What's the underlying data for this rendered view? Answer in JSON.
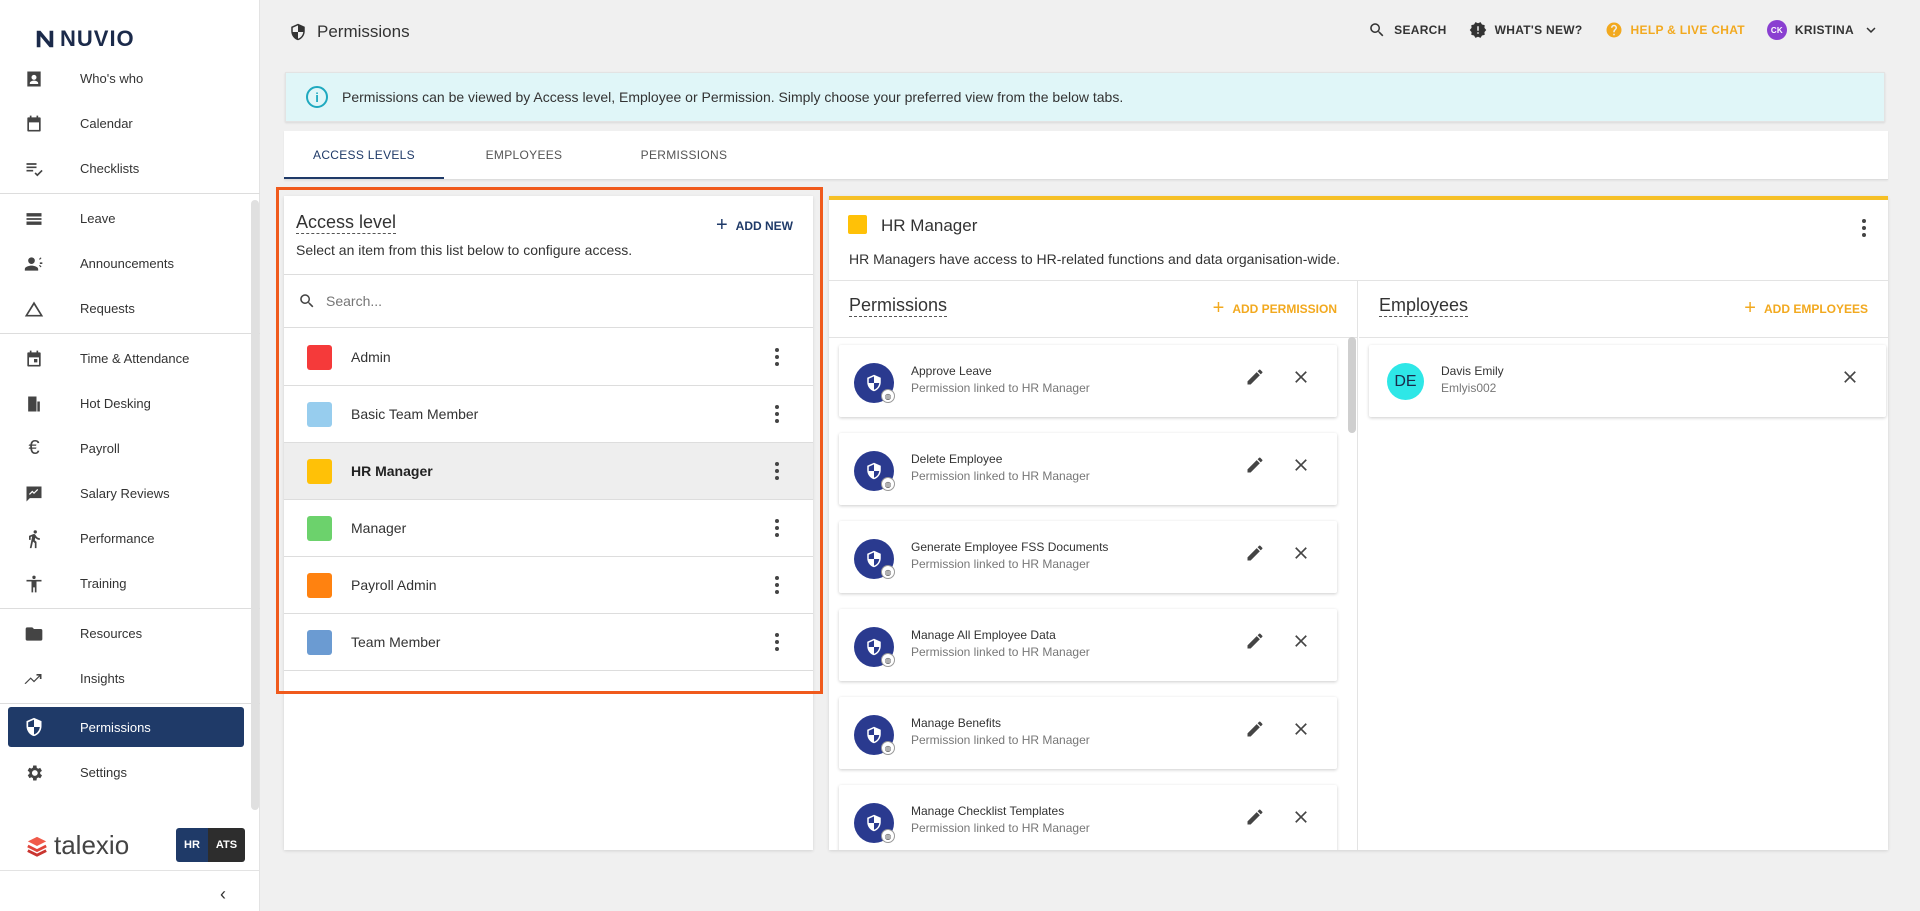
{
  "brand": {
    "logo_text": "NUVIO",
    "footer_brand": "talexio",
    "switch": [
      "HR",
      "ATS"
    ]
  },
  "sidebar": {
    "items": [
      {
        "label": "Who's who",
        "icon": "badge-icon"
      },
      {
        "label": "Calendar",
        "icon": "calendar-icon"
      },
      {
        "label": "Checklists",
        "icon": "checklist-icon"
      },
      {
        "label": "Leave",
        "icon": "leave-icon"
      },
      {
        "label": "Announcements",
        "icon": "megaphone-icon"
      },
      {
        "label": "Requests",
        "icon": "triangle-icon"
      },
      {
        "label": "Time & Attendance",
        "icon": "clock-calendar-icon"
      },
      {
        "label": "Hot Desking",
        "icon": "desk-icon"
      },
      {
        "label": "Payroll",
        "icon": "euro-icon"
      },
      {
        "label": "Salary Reviews",
        "icon": "review-icon"
      },
      {
        "label": "Performance",
        "icon": "runner-icon"
      },
      {
        "label": "Training",
        "icon": "training-icon"
      },
      {
        "label": "Resources",
        "icon": "folder-icon"
      },
      {
        "label": "Insights",
        "icon": "insights-icon"
      },
      {
        "label": "Permissions",
        "icon": "shield-icon"
      },
      {
        "label": "Settings",
        "icon": "gear-icon"
      }
    ]
  },
  "header": {
    "title": "Permissions",
    "search": "SEARCH",
    "whats_new": "WHAT'S NEW?",
    "help": "HELP & LIVE CHAT",
    "user_initials": "CK",
    "user_name": "KRISTINA"
  },
  "banner": {
    "text": "Permissions can be viewed by Access level, Employee or Permission. Simply choose your preferred view from the below tabs."
  },
  "tabs": [
    "ACCESS LEVELS",
    "EMPLOYEES",
    "PERMISSIONS"
  ],
  "access_level": {
    "title": "Access level",
    "add_new": "ADD NEW",
    "subtitle": "Select an item from this list below to configure access.",
    "search_placeholder": "Search...",
    "items": [
      {
        "label": "Admin",
        "color": "#f53a3a"
      },
      {
        "label": "Basic Team Member",
        "color": "#97cdee"
      },
      {
        "label": "HR Manager",
        "color": "#ffc107"
      },
      {
        "label": "Manager",
        "color": "#6cd26c"
      },
      {
        "label": "Payroll Admin",
        "color": "#ff8210"
      },
      {
        "label": "Team Member",
        "color": "#6b9bd2"
      }
    ]
  },
  "detail": {
    "title": "HR Manager",
    "color": "#ffc107",
    "description": "HR Managers have access to HR-related functions and data organisation-wide.",
    "permissions_title": "Permissions",
    "add_permission": "ADD PERMISSION",
    "employees_title": "Employees",
    "add_employees": "ADD EMPLOYEES",
    "permissions": [
      {
        "name": "Approve Leave",
        "sub": "Permission linked to HR Manager"
      },
      {
        "name": "Delete Employee",
        "sub": "Permission linked to HR Manager"
      },
      {
        "name": "Generate Employee FSS Documents",
        "sub": "Permission linked to HR Manager"
      },
      {
        "name": "Manage All Employee Data",
        "sub": "Permission linked to HR Manager"
      },
      {
        "name": "Manage Benefits",
        "sub": "Permission linked to HR Manager"
      },
      {
        "name": "Manage Checklist Templates",
        "sub": "Permission linked to HR Manager"
      }
    ],
    "employees": [
      {
        "initials": "DE",
        "name": "Davis Emily",
        "sub": "Emlyis002"
      }
    ]
  }
}
